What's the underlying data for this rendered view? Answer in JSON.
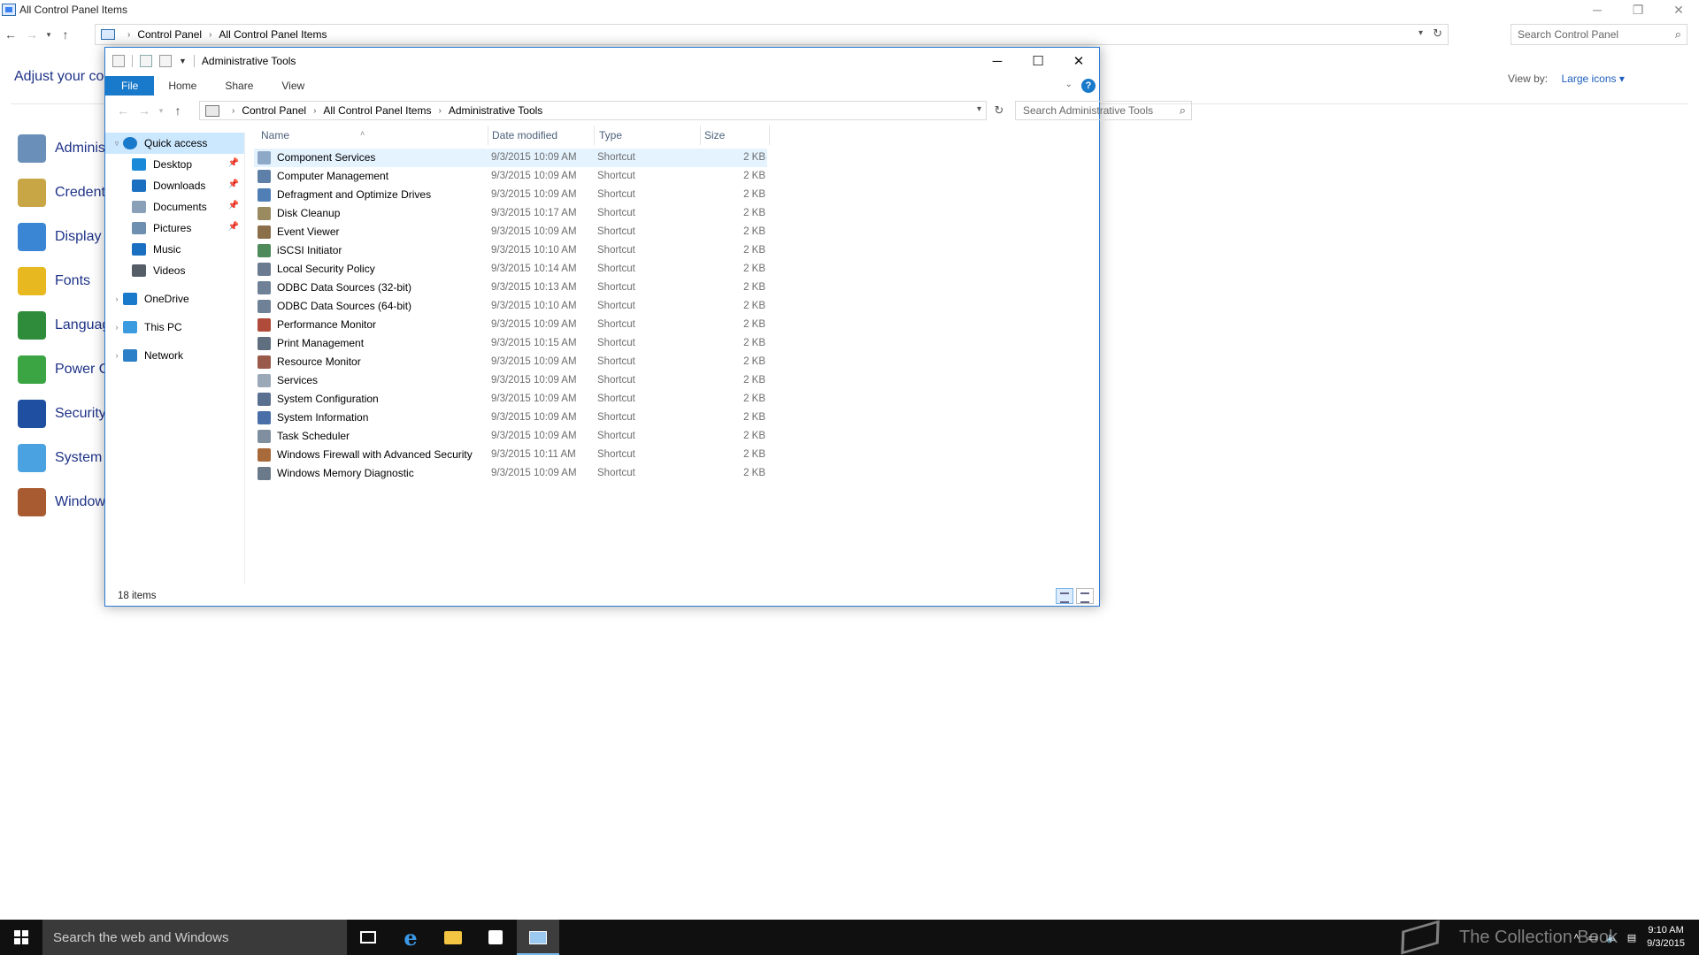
{
  "cp_window": {
    "title": "All Control Panel Items",
    "breadcrumbs": [
      "Control Panel",
      "All Control Panel Items"
    ],
    "search_placeholder": "Search Control Panel",
    "heading": "Adjust your co",
    "view_by_label": "View by:",
    "view_by_value": "Large icons ▾",
    "items": [
      {
        "label": "Administ",
        "icon": "admin-tools-icon",
        "color": "#6a8fb8"
      },
      {
        "label": "Credent",
        "icon": "credential-icon",
        "color": "#c8a545"
      },
      {
        "label": "Display",
        "icon": "display-icon",
        "color": "#3a86d4"
      },
      {
        "label": "Fonts",
        "icon": "fonts-icon",
        "color": "#e8b820"
      },
      {
        "label": "Languag",
        "icon": "language-icon",
        "color": "#2e8c3a"
      },
      {
        "label": "Power O",
        "icon": "power-icon",
        "color": "#3ba544"
      },
      {
        "label": "Security",
        "icon": "security-icon",
        "color": "#1e4fa0"
      },
      {
        "label": "System",
        "icon": "system-icon",
        "color": "#4aa3e0"
      },
      {
        "label": "Window",
        "icon": "firewall-icon",
        "color": "#a85a30"
      }
    ]
  },
  "explorer": {
    "title": "Administrative Tools",
    "ribbon_tabs": [
      "File",
      "Home",
      "Share",
      "View"
    ],
    "breadcrumbs": [
      "Control Panel",
      "All Control Panel Items",
      "Administrative Tools"
    ],
    "search_placeholder": "Search Administrative Tools",
    "columns": {
      "name": "Name",
      "date": "Date modified",
      "type": "Type",
      "size": "Size"
    },
    "sidebar": [
      {
        "label": "Quick access",
        "level": 1,
        "expander": "▿",
        "pinned": false,
        "selected": true,
        "icon": "star-icon",
        "color": "#1979ca"
      },
      {
        "label": "Desktop",
        "level": 2,
        "expander": "",
        "pinned": true,
        "selected": false,
        "icon": "desktop-icon",
        "color": "#1a8ad8"
      },
      {
        "label": "Downloads",
        "level": 2,
        "expander": "",
        "pinned": true,
        "selected": false,
        "icon": "downloads-icon",
        "color": "#1a6fc0"
      },
      {
        "label": "Documents",
        "level": 2,
        "expander": "",
        "pinned": true,
        "selected": false,
        "icon": "documents-icon",
        "color": "#8aa0b8"
      },
      {
        "label": "Pictures",
        "level": 2,
        "expander": "",
        "pinned": true,
        "selected": false,
        "icon": "pictures-icon",
        "color": "#6f8fb0"
      },
      {
        "label": "Music",
        "level": 2,
        "expander": "",
        "pinned": false,
        "selected": false,
        "icon": "music-icon",
        "color": "#1a6fc0"
      },
      {
        "label": "Videos",
        "level": 2,
        "expander": "",
        "pinned": false,
        "selected": false,
        "icon": "videos-icon",
        "color": "#555d66"
      },
      {
        "label": "OneDrive",
        "level": 1,
        "expander": "›",
        "pinned": false,
        "selected": false,
        "icon": "onedrive-icon",
        "color": "#1979ca"
      },
      {
        "label": "This PC",
        "level": 1,
        "expander": "›",
        "pinned": false,
        "selected": false,
        "icon": "computer-icon",
        "color": "#3a9be0"
      },
      {
        "label": "Network",
        "level": 1,
        "expander": "›",
        "pinned": false,
        "selected": false,
        "icon": "network-icon",
        "color": "#2a7fc8"
      }
    ],
    "files": [
      {
        "name": "Component Services",
        "date": "9/3/2015 10:09 AM",
        "type": "Shortcut",
        "size": "2 KB",
        "icon_color": "#8ea9c8"
      },
      {
        "name": "Computer Management",
        "date": "9/3/2015 10:09 AM",
        "type": "Shortcut",
        "size": "2 KB",
        "icon_color": "#5d7fa8"
      },
      {
        "name": "Defragment and Optimize Drives",
        "date": "9/3/2015 10:09 AM",
        "type": "Shortcut",
        "size": "2 KB",
        "icon_color": "#4f7fb5"
      },
      {
        "name": "Disk Cleanup",
        "date": "9/3/2015 10:17 AM",
        "type": "Shortcut",
        "size": "2 KB",
        "icon_color": "#9a8a60"
      },
      {
        "name": "Event Viewer",
        "date": "9/3/2015 10:09 AM",
        "type": "Shortcut",
        "size": "2 KB",
        "icon_color": "#8a6f4a"
      },
      {
        "name": "iSCSI Initiator",
        "date": "9/3/2015 10:10 AM",
        "type": "Shortcut",
        "size": "2 KB",
        "icon_color": "#4e8a5a"
      },
      {
        "name": "Local Security Policy",
        "date": "9/3/2015 10:14 AM",
        "type": "Shortcut",
        "size": "2 KB",
        "icon_color": "#6a7a90"
      },
      {
        "name": "ODBC Data Sources (32-bit)",
        "date": "9/3/2015 10:13 AM",
        "type": "Shortcut",
        "size": "2 KB",
        "icon_color": "#6f8196"
      },
      {
        "name": "ODBC Data Sources (64-bit)",
        "date": "9/3/2015 10:10 AM",
        "type": "Shortcut",
        "size": "2 KB",
        "icon_color": "#6f8196"
      },
      {
        "name": "Performance Monitor",
        "date": "9/3/2015 10:09 AM",
        "type": "Shortcut",
        "size": "2 KB",
        "icon_color": "#b04a3a"
      },
      {
        "name": "Print Management",
        "date": "9/3/2015 10:15 AM",
        "type": "Shortcut",
        "size": "2 KB",
        "icon_color": "#5f6f80"
      },
      {
        "name": "Resource Monitor",
        "date": "9/3/2015 10:09 AM",
        "type": "Shortcut",
        "size": "2 KB",
        "icon_color": "#9a5a4a"
      },
      {
        "name": "Services",
        "date": "9/3/2015 10:09 AM",
        "type": "Shortcut",
        "size": "2 KB",
        "icon_color": "#9aa8b8"
      },
      {
        "name": "System Configuration",
        "date": "9/3/2015 10:09 AM",
        "type": "Shortcut",
        "size": "2 KB",
        "icon_color": "#5a7090"
      },
      {
        "name": "System Information",
        "date": "9/3/2015 10:09 AM",
        "type": "Shortcut",
        "size": "2 KB",
        "icon_color": "#4a6fa8"
      },
      {
        "name": "Task Scheduler",
        "date": "9/3/2015 10:09 AM",
        "type": "Shortcut",
        "size": "2 KB",
        "icon_color": "#7f8f9f"
      },
      {
        "name": "Windows Firewall with Advanced Security",
        "date": "9/3/2015 10:11 AM",
        "type": "Shortcut",
        "size": "2 KB",
        "icon_color": "#a86a3a"
      },
      {
        "name": "Windows Memory Diagnostic",
        "date": "9/3/2015 10:09 AM",
        "type": "Shortcut",
        "size": "2 KB",
        "icon_color": "#6a7a8a"
      }
    ],
    "status": "18 items"
  },
  "taskbar": {
    "search_placeholder": "Search the web and Windows",
    "watermark": "The Collection Book",
    "time": "9:10 AM",
    "date": "9/3/2015"
  },
  "colors": {
    "accent": "#1979ca",
    "link": "#1e3287",
    "selection": "#cce8ff",
    "hover": "#e5f3ff"
  }
}
